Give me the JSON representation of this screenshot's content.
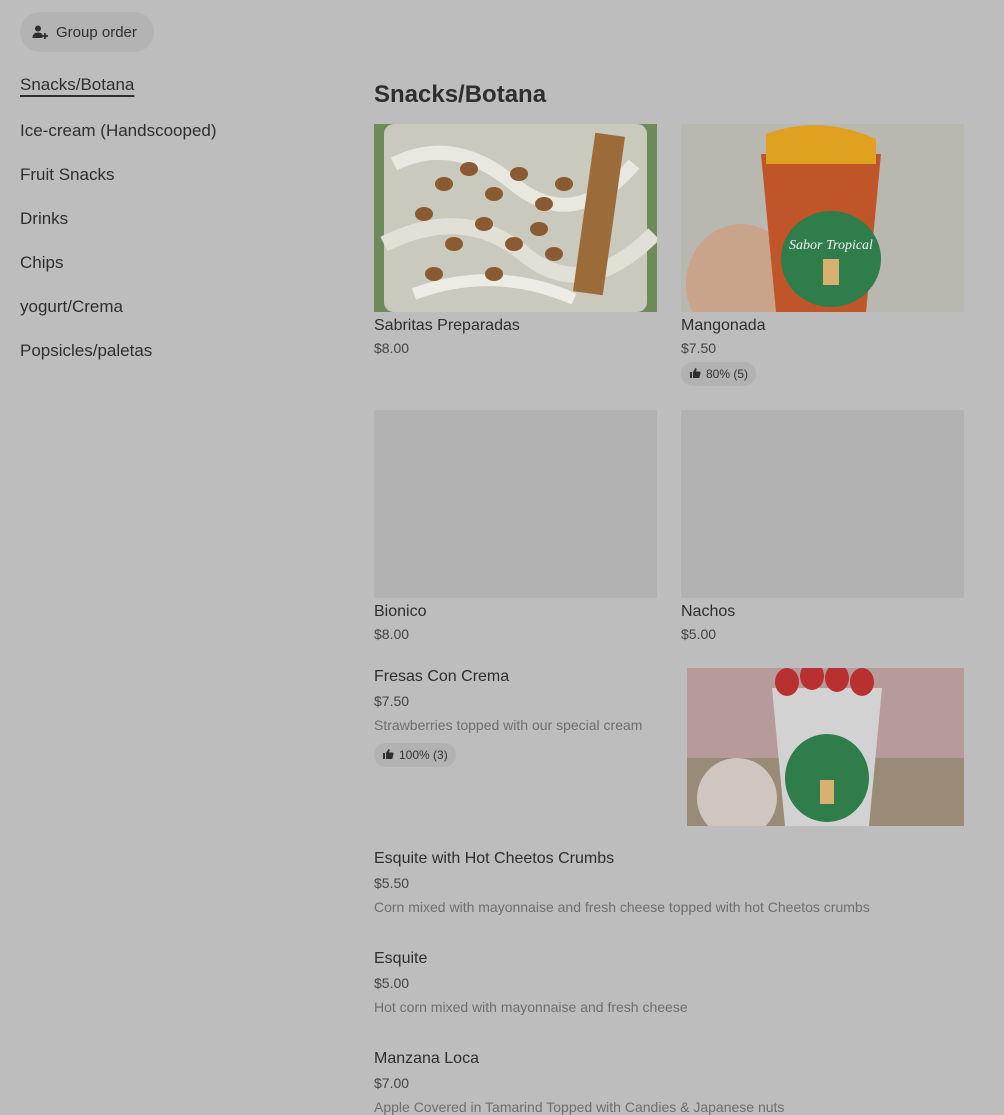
{
  "header": {
    "group_order_label": "Group order"
  },
  "sidebar": {
    "items": [
      {
        "label": "Snacks/Botana"
      },
      {
        "label": "Ice-cream (Handscooped)"
      },
      {
        "label": "Fruit Snacks"
      },
      {
        "label": "Drinks"
      },
      {
        "label": "Chips"
      },
      {
        "label": "yogurt/Crema"
      },
      {
        "label": "Popsicles/paletas"
      }
    ]
  },
  "section": {
    "title": "Snacks/Botana"
  },
  "grid_items": [
    {
      "name": "Sabritas Preparadas",
      "price": "$8.00"
    },
    {
      "name": "Mangonada",
      "price": "$7.50",
      "rating": "80% (5)"
    },
    {
      "name": "Bionico",
      "price": "$8.00"
    },
    {
      "name": "Nachos",
      "price": "$5.00"
    }
  ],
  "list_items": [
    {
      "name": "Fresas Con Crema",
      "price": "$7.50",
      "description": "Strawberries topped with our special cream",
      "rating": "100% (3)"
    },
    {
      "name": "Esquite with Hot Cheetos Crumbs",
      "price": "$5.50",
      "description": "Corn mixed with mayonnaise and fresh cheese topped with hot Cheetos crumbs"
    },
    {
      "name": "Esquite",
      "price": "$5.00",
      "description": "Hot corn mixed with mayonnaise and fresh cheese"
    },
    {
      "name": "Manzana Loca",
      "price": "$7.00",
      "description": "Apple Covered in Tamarind Topped with Candies & Japanese nuts"
    }
  ],
  "image_texts": {
    "cup_logo": "Sabor Tropical"
  }
}
